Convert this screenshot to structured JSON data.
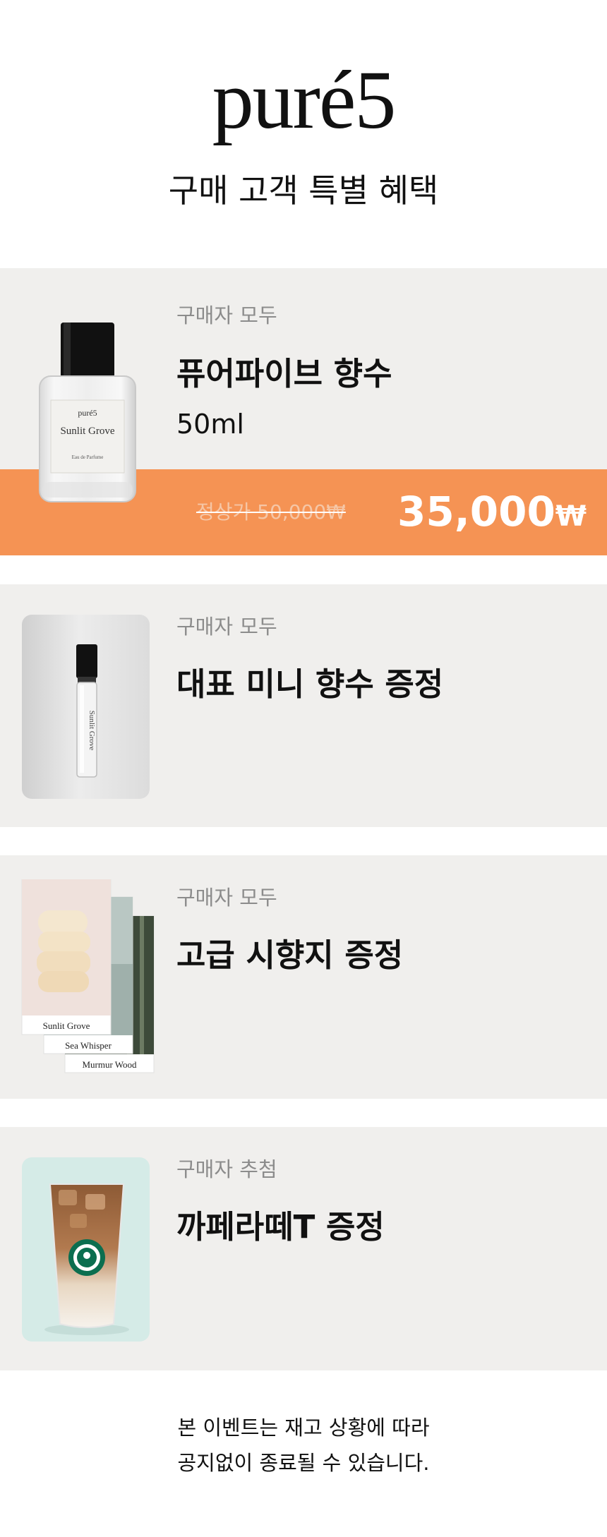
{
  "header": {
    "logo_text": "puré5",
    "title": "구매 고객 특별 혜택"
  },
  "offers": [
    {
      "audience": "구매자 모두",
      "title": "퓨어파이브 향수",
      "subtitle": "50ml",
      "product_label": {
        "brand": "puré5",
        "name": "Sunlit Grove",
        "type": "Eau de Parfume"
      },
      "regular_price": "정상가 50,000₩",
      "sale_price": "35,000",
      "currency": "₩"
    },
    {
      "audience": "구매자 모두",
      "title": "대표 미니 향수 증정",
      "vial_label": "Sunlit Grove"
    },
    {
      "audience": "구매자 모두",
      "title": "고급 시향지 증정",
      "cards": [
        "Sunlit Grove",
        "Sea Whisper",
        "Murmur Wood"
      ]
    },
    {
      "audience": "구매자 추첨",
      "title": "까페라떼T 증정"
    }
  ],
  "footer": {
    "line1": "본 이벤트는 재고 상황에 따라",
    "line2": "공지없이 종료될 수 있습니다."
  },
  "colors": {
    "accent": "#f59354",
    "card_bg": "#f0efed",
    "muted_text": "#8c8c8c"
  }
}
